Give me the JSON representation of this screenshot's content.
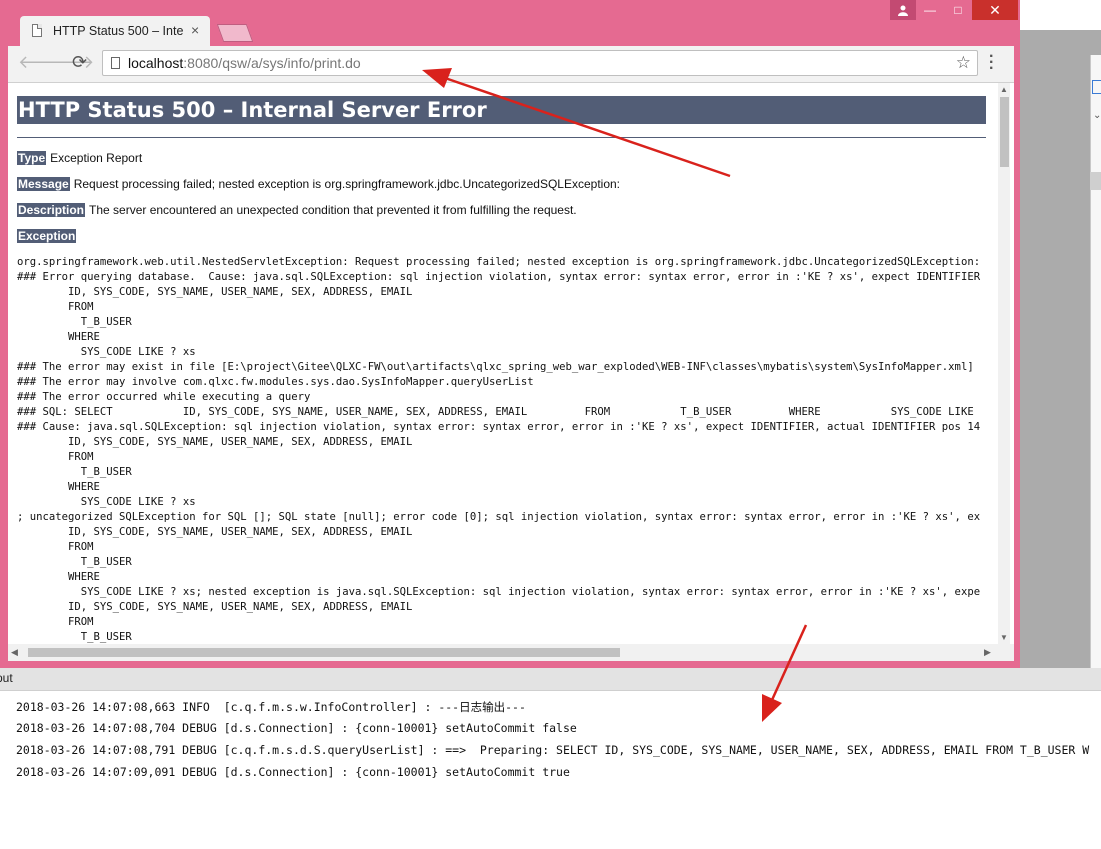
{
  "browser": {
    "tab_title": "HTTP Status 500 – Inte",
    "tab_close": "×",
    "url_host": "localhost",
    "url_rest": ":8080/qsw/a/sys/info/print.do",
    "window_controls": {
      "minimize": "—",
      "maximize": "□",
      "close": "✕"
    }
  },
  "page": {
    "title": "HTTP Status 500 – Internal Server Error",
    "type_label": "Type",
    "type_value": "Exception Report",
    "message_label": "Message",
    "message_value": "Request processing failed; nested exception is org.springframework.jdbc.UncategorizedSQLException:",
    "description_label": "Description",
    "description_value": "The server encountered an unexpected condition that prevented it from fulfilling the request.",
    "exception_label": "Exception",
    "trace": "org.springframework.web.util.NestedServletException: Request processing failed; nested exception is org.springframework.jdbc.UncategorizedSQLException:\n### Error querying database.  Cause: java.sql.SQLException: sql injection violation, syntax error: syntax error, error in :'KE ? xs', expect IDENTIFIER\n        ID, SYS_CODE, SYS_NAME, USER_NAME, SEX, ADDRESS, EMAIL\n        FROM\n          T_B_USER\n        WHERE\n          SYS_CODE LIKE ? xs\n### The error may exist in file [E:\\project\\Gitee\\QLXC-FW\\out\\artifacts\\qlxc_spring_web_war_exploded\\WEB-INF\\classes\\mybatis\\system\\SysInfoMapper.xml]\n### The error may involve com.qlxc.fw.modules.sys.dao.SysInfoMapper.queryUserList\n### The error occurred while executing a query\n### SQL: SELECT           ID, SYS_CODE, SYS_NAME, USER_NAME, SEX, ADDRESS, EMAIL         FROM           T_B_USER         WHERE           SYS_CODE LIKE\n### Cause: java.sql.SQLException: sql injection violation, syntax error: syntax error, error in :'KE ? xs', expect IDENTIFIER, actual IDENTIFIER pos 14\n        ID, SYS_CODE, SYS_NAME, USER_NAME, SEX, ADDRESS, EMAIL\n        FROM\n          T_B_USER\n        WHERE\n          SYS_CODE LIKE ? xs\n; uncategorized SQLException for SQL []; SQL state [null]; error code [0]; sql injection violation, syntax error: syntax error, error in :'KE ? xs', ex\n        ID, SYS_CODE, SYS_NAME, USER_NAME, SEX, ADDRESS, EMAIL\n        FROM\n          T_B_USER\n        WHERE\n          SYS_CODE LIKE ? xs; nested exception is java.sql.SQLException: sql injection violation, syntax error: syntax error, error in :'KE ? xs', expe\n        ID, SYS_CODE, SYS_NAME, USER_NAME, SEX, ADDRESS, EMAIL\n        FROM\n          T_B_USER"
  },
  "ide": {
    "output_tab": "put",
    "log_lines": [
      "2018-03-26 14:07:08,663 INFO  [c.q.f.m.s.w.InfoController] : ---日志输出---",
      "2018-03-26 14:07:08,704 DEBUG [d.s.Connection] : {conn-10001} setAutoCommit false",
      "2018-03-26 14:07:08,791 DEBUG [c.q.f.m.s.d.S.queryUserList] : ==>  Preparing: SELECT ID, SYS_CODE, SYS_NAME, USER_NAME, SEX, ADDRESS, EMAIL FROM T_B_USER W",
      "2018-03-26 14:07:09,091 DEBUG [d.s.Connection] : {conn-10001} setAutoCommit true"
    ]
  },
  "colors": {
    "browser_frame": "#e56a91",
    "tomcat_header": "#525d76",
    "annotation_arrow": "#d9221c"
  }
}
